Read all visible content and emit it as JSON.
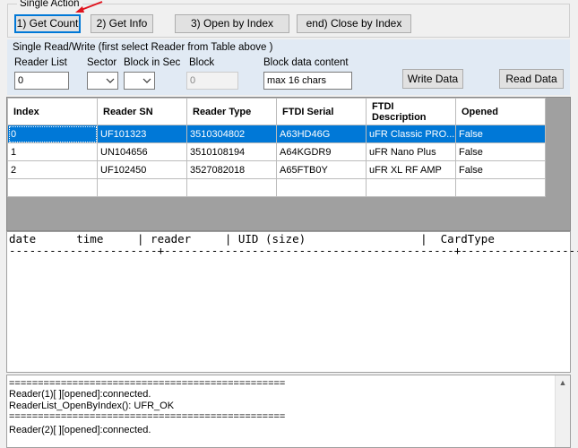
{
  "single_action": {
    "title": "Single Action",
    "buttons": {
      "get_count": "1) Get Count",
      "get_info": "2) Get Info",
      "open_by_index": "3) Open by Index",
      "close_by_index": "end) Close by Index"
    }
  },
  "read_write": {
    "title": "Single Read/Write  (first select Reader from Table above )",
    "reader_list_label": "Reader List",
    "reader_list_value": "0",
    "sector_label": "Sector",
    "block_in_sec_label": "Block in Sec",
    "block_label": "Block",
    "block_value": "0",
    "block_data_label": "Block data content",
    "block_data_value": "max 16 chars",
    "write_button": "Write Data",
    "read_button": "Read Data"
  },
  "grid": {
    "columns": [
      "Index",
      "Reader SN",
      "Reader Type",
      "FTDI Serial",
      "FTDI Description",
      "Opened"
    ],
    "rows": [
      [
        "0",
        "UF101323",
        "3510304802",
        "A63HD46G",
        "uFR Classic PRO...",
        "False"
      ],
      [
        "1",
        "UN104656",
        "3510108194",
        "A64KGDR9",
        "uFR Nano Plus",
        "False"
      ],
      [
        "2",
        "UF102450",
        "3527082018",
        "A65FTB0Y",
        "uFR XL RF AMP",
        "False"
      ]
    ],
    "selected_row": 0
  },
  "log": {
    "header": "date      time     | reader     | UID (size)                 |  CardType",
    "separator": "----------------------+-------------------------------------------+------------------"
  },
  "bottom_log": {
    "lines": [
      "================================================",
      "Reader(1)[ ][opened]:connected.",
      "ReaderList_OpenByIndex(): UFR_OK",
      "================================================",
      "",
      "Reader(2)[ ][opened]:connected."
    ]
  },
  "colors": {
    "accent": "#0078d7",
    "arrow": "#e0141e",
    "panel_blue": "#e1eaf4"
  }
}
